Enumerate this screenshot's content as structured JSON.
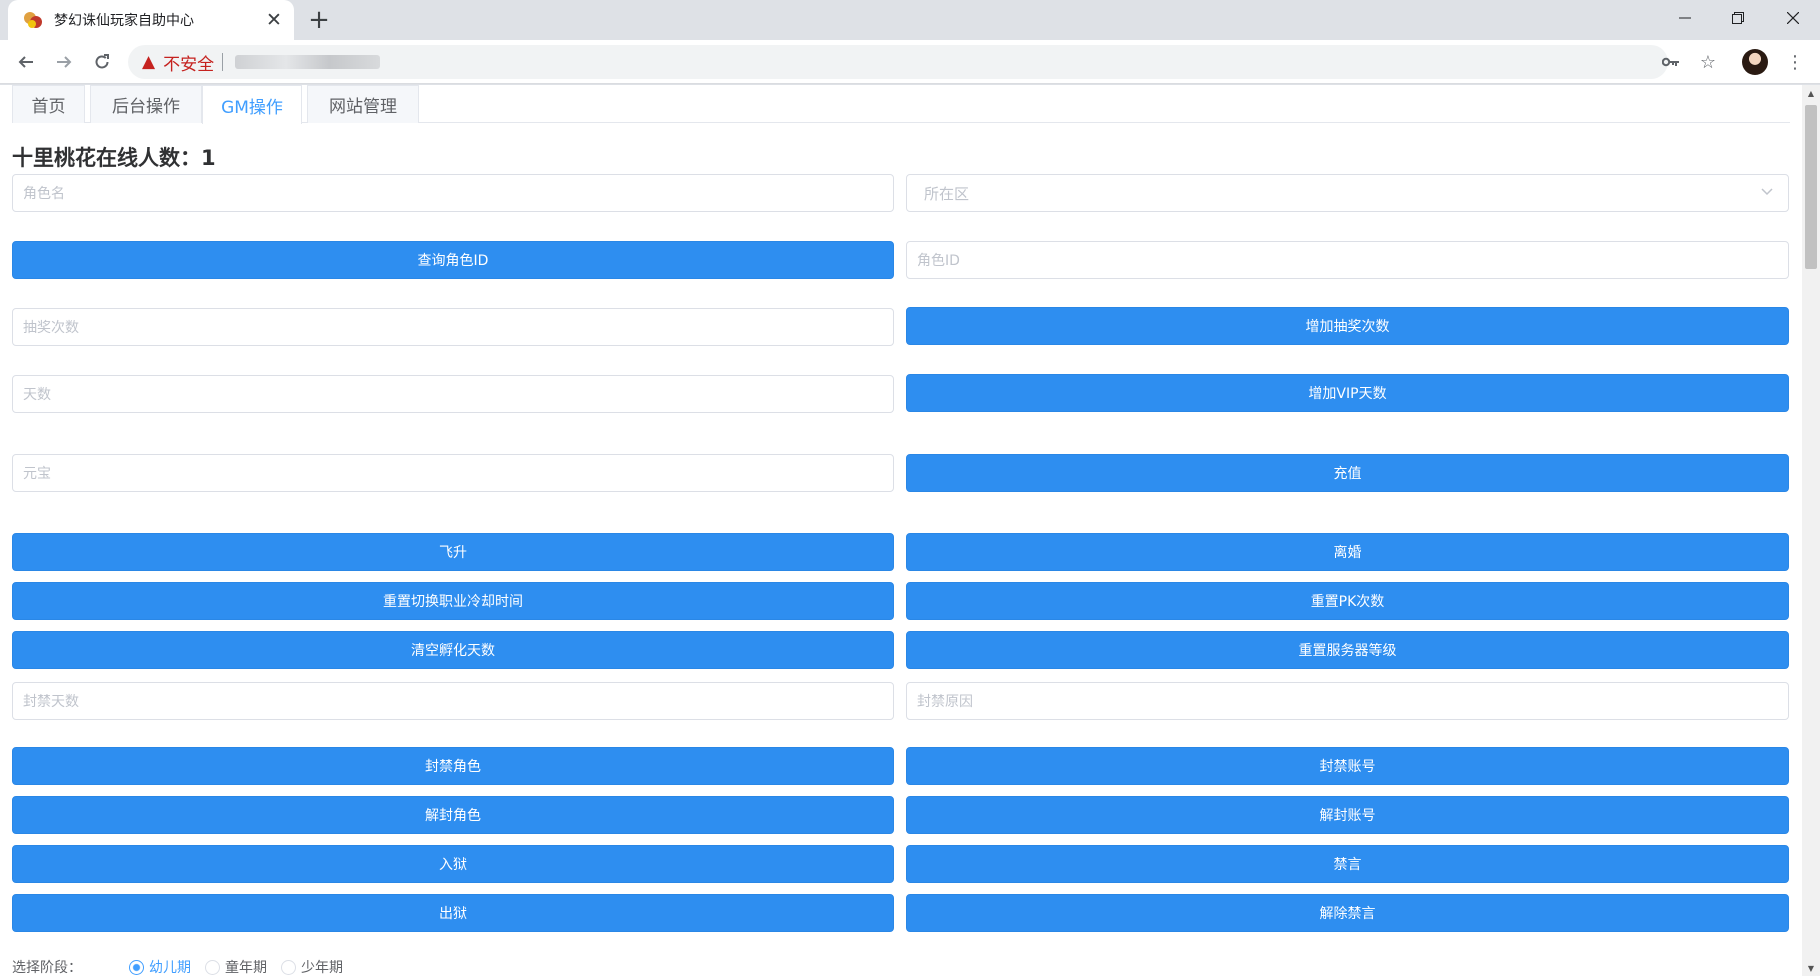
{
  "browser": {
    "tab_title": "梦幻诛仙玩家自助中心",
    "security_label": "不安全"
  },
  "nav": {
    "tabs": [
      {
        "label": "首页",
        "active": false
      },
      {
        "label": "后台操作",
        "active": false
      },
      {
        "label": "GM操作",
        "active": true
      },
      {
        "label": "网站管理",
        "active": false
      }
    ]
  },
  "page": {
    "heading": "十里桃花在线人数：1"
  },
  "fields": {
    "role_name": "角色名",
    "region": "所在区",
    "role_id": "角色ID",
    "lottery_count": "抽奖次数",
    "days": "天数",
    "yuanbao": "元宝",
    "ban_days": "封禁天数",
    "ban_reason": "封禁原因"
  },
  "buttons": {
    "query_role_id": "查询角色ID",
    "add_lottery": "增加抽奖次数",
    "add_vip_days": "增加VIP天数",
    "recharge": "充值",
    "ascend": "飞升",
    "divorce": "离婚",
    "reset_job_cooldown": "重置切换职业冷却时间",
    "reset_pk": "重置PK次数",
    "clear_hatch_days": "清空孵化天数",
    "reset_server_level": "重置服务器等级",
    "ban_role": "封禁角色",
    "ban_account": "封禁账号",
    "unban_role": "解封角色",
    "unban_account": "解封账号",
    "jail": "入狱",
    "mute": "禁言",
    "release": "出狱",
    "unmute": "解除禁言"
  },
  "stage": {
    "label": "选择阶段：",
    "options": [
      {
        "label": "幼儿期",
        "checked": true
      },
      {
        "label": "童年期",
        "checked": false
      },
      {
        "label": "少年期",
        "checked": false
      }
    ]
  }
}
